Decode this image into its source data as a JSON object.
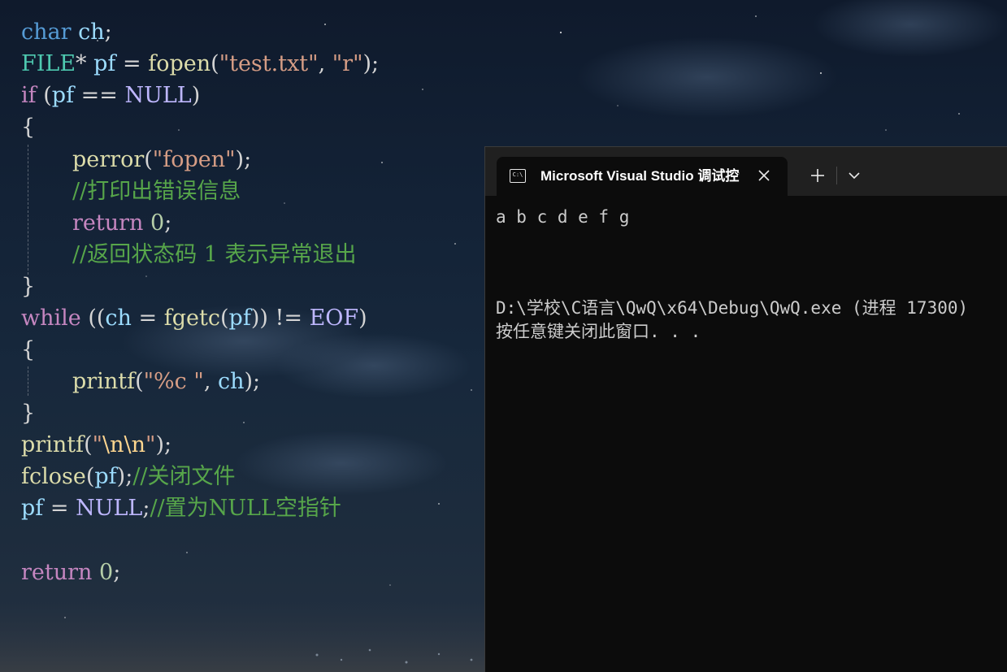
{
  "console": {
    "tab_title": "Microsoft Visual Studio 调试控制台",
    "output_line_1": "a b c d e f g",
    "output_line_2": "D:\\学校\\C语言\\QwQ\\x64\\Debug\\QwQ.exe (进程 17300)",
    "output_line_3": "按任意键关闭此窗口. . ."
  },
  "code": {
    "l1": [
      "char",
      "ch",
      ";"
    ],
    "l2": [
      "FILE",
      "*",
      "pf",
      "=",
      "fopen",
      "(",
      "\"test.txt\"",
      ",",
      "\"r\"",
      ");"
    ],
    "l3": [
      "if",
      "(",
      "pf",
      "==",
      "NULL",
      ")"
    ],
    "l4": [
      "{"
    ],
    "l5": [
      "perror",
      "(",
      "\"fopen\"",
      ");"
    ],
    "l6": [
      "//打印出错误信息"
    ],
    "l7": [
      "return",
      "0",
      ";"
    ],
    "l8": [
      "//返回状态码 1 表示异常退出"
    ],
    "l9": [
      "}"
    ],
    "l10": [
      "while",
      "((",
      "ch",
      "=",
      "fgetc",
      "(",
      "pf",
      "))",
      "!=",
      "EOF",
      ")"
    ],
    "l11": [
      "{"
    ],
    "l12": [
      "printf",
      "(",
      "\"%c \"",
      ",",
      "ch",
      ");"
    ],
    "l13": [
      "}"
    ],
    "l14": [
      "printf",
      "(",
      "\"",
      "\\n\\n",
      "\"",
      ");"
    ],
    "l15": [
      "fclose",
      "(",
      "pf",
      ");",
      "//关闭文件"
    ],
    "l16": [
      "pf",
      "=",
      "NULL",
      ";",
      "//置为NULL空指针"
    ],
    "l17": [
      "return",
      "0",
      ";"
    ]
  },
  "colors": {
    "keyword": "#569cd6",
    "control_keyword": "#c586c0",
    "type": "#4ec9b0",
    "variable": "#9cdcfe",
    "function": "#dcdcaa",
    "string": "#d69d85",
    "number": "#b5cea8",
    "macro": "#beb7ff",
    "comment": "#57a64a",
    "console_bg": "#0c0c0c",
    "titlebar_bg": "#202020"
  }
}
